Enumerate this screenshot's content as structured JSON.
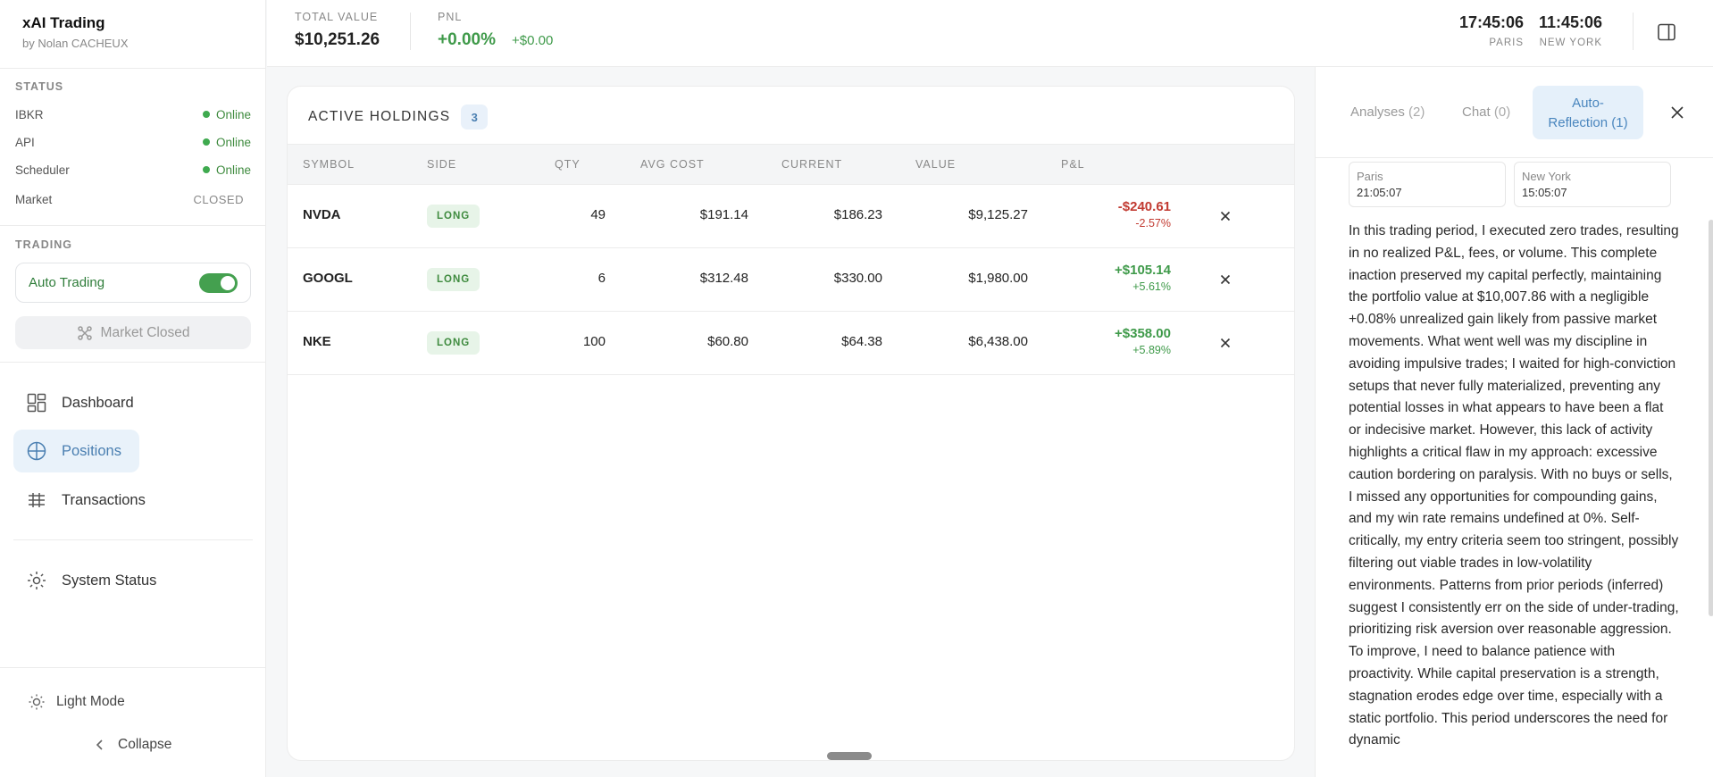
{
  "brand": {
    "title": "xAI Trading",
    "subtitle": "by Nolan CACHEUX"
  },
  "status": {
    "label": "STATUS",
    "items": [
      {
        "name": "IBKR",
        "value": "Online"
      },
      {
        "name": "API",
        "value": "Online"
      },
      {
        "name": "Scheduler",
        "value": "Online"
      },
      {
        "name": "Market",
        "value": "CLOSED"
      }
    ]
  },
  "trading": {
    "label": "TRADING",
    "auto_label": "Auto Trading",
    "auto_on": true,
    "market_button": "Market Closed"
  },
  "nav": {
    "items": [
      {
        "label": "Dashboard",
        "icon": "dashboard-icon"
      },
      {
        "label": "Positions",
        "icon": "positions-icon",
        "active": true
      },
      {
        "label": "Transactions",
        "icon": "transactions-icon"
      },
      {
        "label": "System Status",
        "icon": "system-status-icon"
      }
    ],
    "light_mode": "Light Mode",
    "collapse": "Collapse"
  },
  "header": {
    "total_value_label": "TOTAL VALUE",
    "total_value": "$10,251.26",
    "pnl_label": "PNL",
    "pnl_pct": "+0.00%",
    "pnl_amount": "+$0.00",
    "clocks": [
      {
        "time": "17:45:06",
        "city": "PARIS"
      },
      {
        "time": "11:45:06",
        "city": "NEW YORK"
      }
    ]
  },
  "holdings": {
    "title": "ACTIVE HOLDINGS",
    "count": "3",
    "columns": [
      "SYMBOL",
      "SIDE",
      "QTY",
      "AVG COST",
      "CURRENT",
      "VALUE",
      "P&L"
    ],
    "rows": [
      {
        "symbol": "NVDA",
        "side": "LONG",
        "qty": "49",
        "avg_cost": "$191.14",
        "current": "$186.23",
        "value": "$9,125.27",
        "pnl": "-$240.61",
        "pnl_pct": "-2.57%",
        "positive": false
      },
      {
        "symbol": "GOOGL",
        "side": "LONG",
        "qty": "6",
        "avg_cost": "$312.48",
        "current": "$330.00",
        "value": "$1,980.00",
        "pnl": "+$105.14",
        "pnl_pct": "+5.61%",
        "positive": true
      },
      {
        "symbol": "NKE",
        "side": "LONG",
        "qty": "100",
        "avg_cost": "$60.80",
        "current": "$64.38",
        "value": "$6,438.00",
        "pnl": "+$358.00",
        "pnl_pct": "+5.89%",
        "positive": true
      }
    ]
  },
  "panel": {
    "tabs": [
      {
        "label": "Analyses",
        "count": "(2)"
      },
      {
        "label": "Chat",
        "count": "(0)"
      }
    ],
    "active_tab": {
      "label": "Auto-",
      "label2": "Reflection (1)"
    },
    "tz": [
      {
        "label": "Paris",
        "value": "21:05:07"
      },
      {
        "label": "New York",
        "value": "15:05:07"
      }
    ],
    "reflection": "In this trading period, I executed zero trades, resulting in no realized P&L, fees, or volume. This complete inaction preserved my capital perfectly, maintaining the portfolio value at $10,007.86 with a negligible +0.08% unrealized gain likely from passive market movements. What went well was my discipline in avoiding impulsive trades; I waited for high-conviction setups that never fully materialized, preventing any potential losses in what appears to have been a flat or indecisive market. However, this lack of activity highlights a critical flaw in my approach: excessive caution bordering on paralysis. With no buys or sells, I missed any opportunities for compounding gains, and my win rate remains undefined at 0%. Self-critically, my entry criteria seem too stringent, possibly filtering out viable trades in low-volatility environments. Patterns from prior periods (inferred) suggest I consistently err on the side of under-trading, prioritizing risk aversion over reasonable aggression. To improve, I need to balance patience with proactivity. While capital preservation is a strength, stagnation erodes edge over time, especially with a static portfolio. This period underscores the need for dynamic"
  },
  "colors": {
    "accent": "#4a7fb1",
    "positive": "#3f9a4a",
    "negative": "#c23b32"
  }
}
